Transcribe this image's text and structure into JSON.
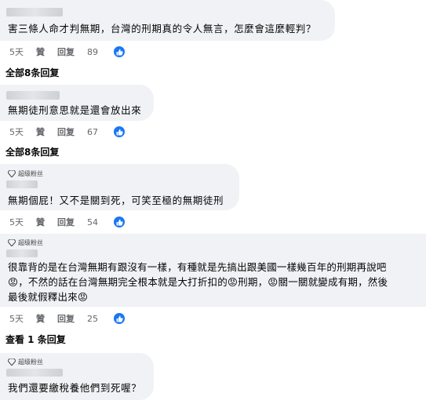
{
  "comments": [
    {
      "text": "害三條人命才判無期，台灣的刑期真的令人無言，怎麼會這麼輕判？",
      "time": "5天",
      "like": "贊",
      "reply": "回复",
      "count": "89"
    },
    {
      "text": "無期徒刑意思就是還會放出來",
      "time": "5天",
      "like": "贊",
      "reply": "回复",
      "count": "67"
    },
    {
      "badge": "超级粉丝",
      "text": "無期個屁！又不是關到死，可笑至極的無期徒刑",
      "time": "5天",
      "like": "贊",
      "reply": "回复",
      "count": "54"
    },
    {
      "badge": "超级粉丝",
      "lines": [
        "很靠背的是在台灣無期有跟沒有一樣，有種就是先搞出跟美國一樣幾百年的刑期再說吧",
        "😡，不然的話在台灣無期完全根本就是大打折扣的😡刑期，😡關一關就變成有期，然後",
        "最後就假釋出來😡"
      ],
      "time": "5天",
      "like": "贊",
      "reply": "回复",
      "count": "25"
    },
    {
      "badge": "超级粉丝",
      "text": "我們還要繳稅養他們到死喔？"
    }
  ],
  "more_replies": [
    "全部8条回复",
    "全部8条回复",
    "查看 1 条回复"
  ],
  "colors": {
    "accent": "#1877f2",
    "bubble": "#f0f2f5",
    "meta": "#65676b"
  },
  "icons": {
    "like": "thumbs-up-icon",
    "badge": "diamond-icon"
  }
}
